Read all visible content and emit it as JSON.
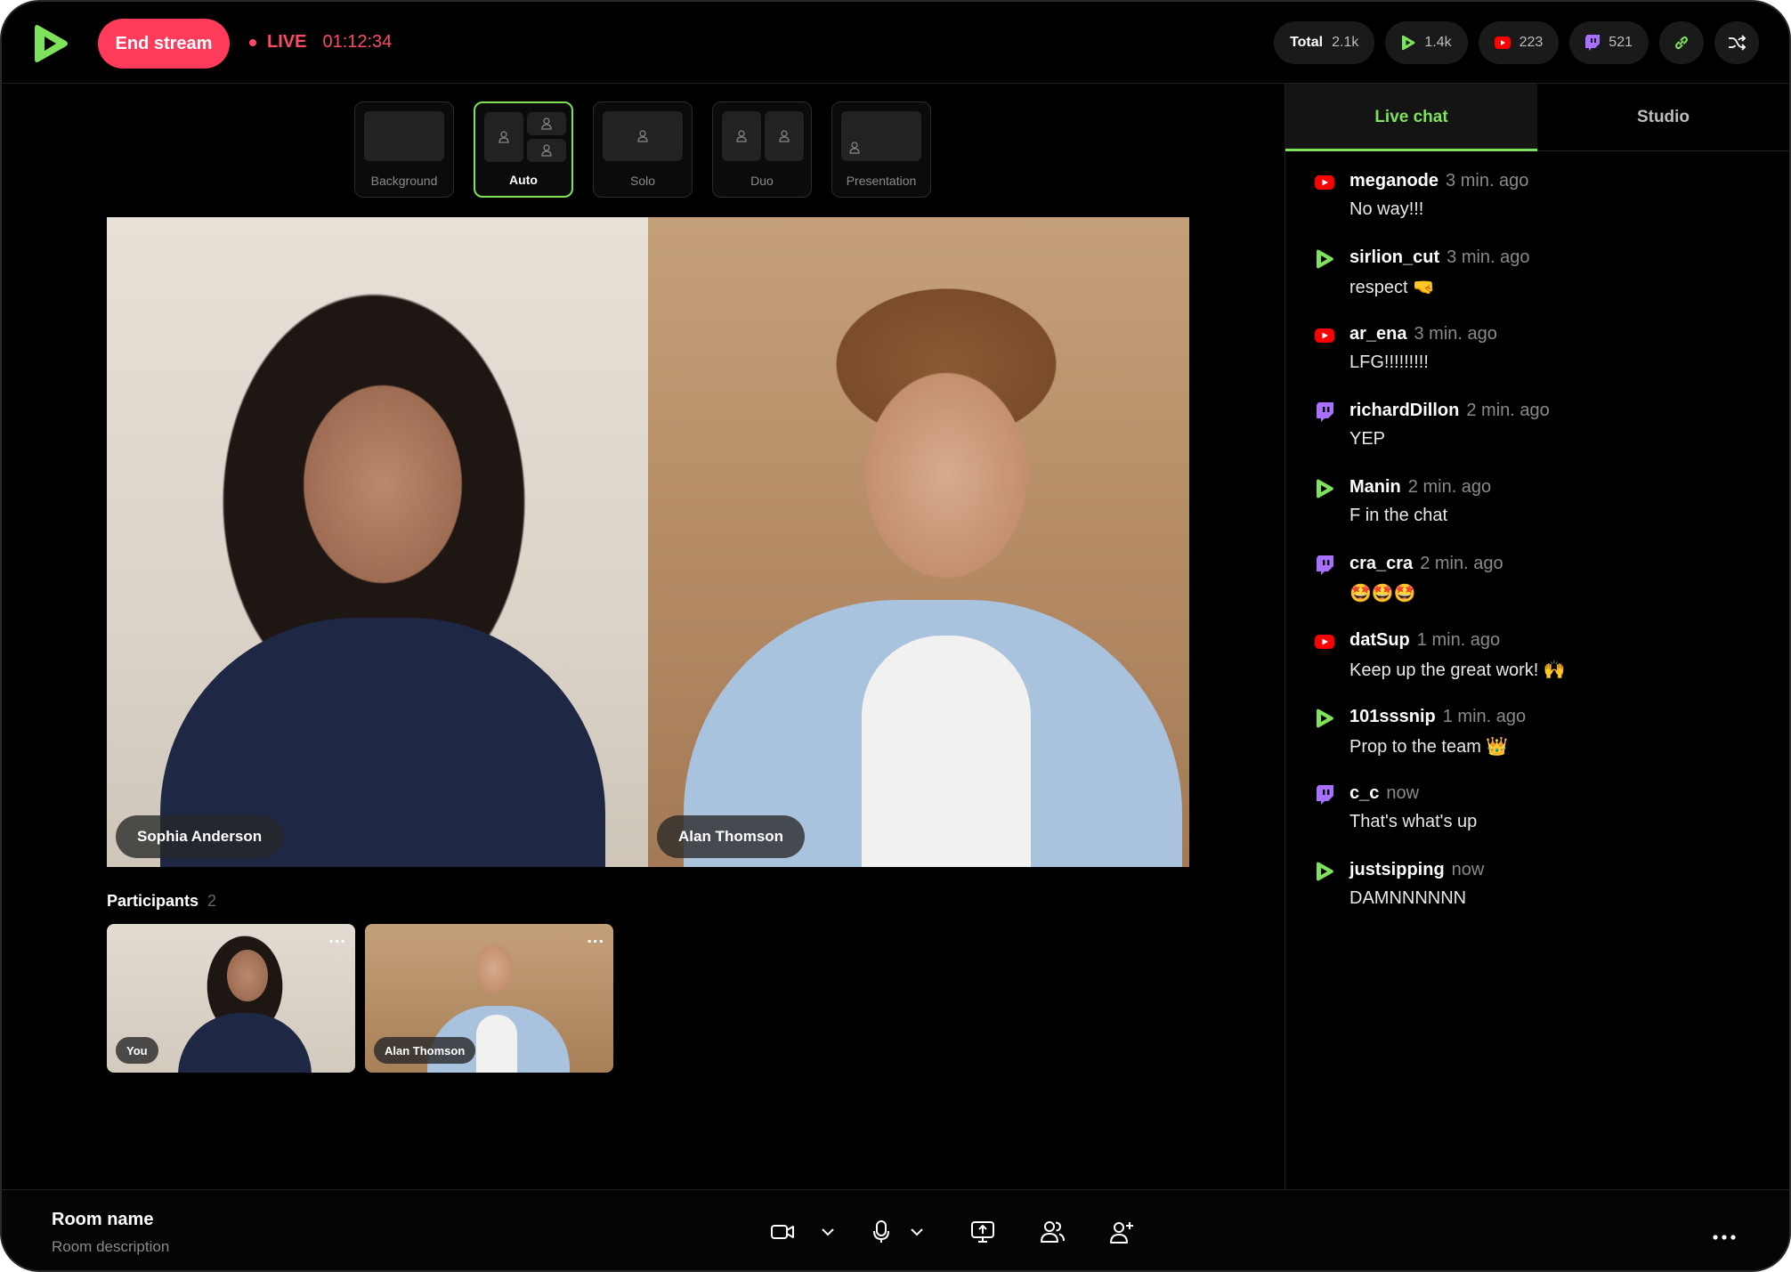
{
  "header": {
    "end_stream_label": "End stream",
    "live_label": "LIVE",
    "timer": "01:12:34",
    "stats": {
      "total_label": "Total",
      "total_value": "2.1k",
      "platform_a_value": "1.4k",
      "youtube_value": "223",
      "twitch_value": "521"
    }
  },
  "layouts": [
    {
      "label": "Background"
    },
    {
      "label": "Auto"
    },
    {
      "label": "Solo"
    },
    {
      "label": "Duo"
    },
    {
      "label": "Presentation"
    }
  ],
  "stage": {
    "speakers": [
      {
        "name": "Sophia Anderson"
      },
      {
        "name": "Alan Thomson"
      }
    ]
  },
  "participants": {
    "title": "Participants",
    "count": "2",
    "tiles": [
      {
        "name": "You",
        "menu": "..."
      },
      {
        "name": "Alan Thomson",
        "menu": "..."
      }
    ]
  },
  "chat": {
    "tabs": [
      {
        "label": "Live chat"
      },
      {
        "label": "Studio"
      }
    ],
    "messages": [
      {
        "platform": "youtube",
        "user": "meganode",
        "time": "3 min. ago",
        "text": "No way!!!"
      },
      {
        "platform": "green",
        "user": "sirlion_cut",
        "time": "3 min. ago",
        "text": "respect 🤜"
      },
      {
        "platform": "youtube",
        "user": "ar_ena",
        "time": "3 min. ago",
        "text": "LFG!!!!!!!!!"
      },
      {
        "platform": "twitch",
        "user": "richardDillon",
        "time": "2 min. ago",
        "text": "YEP"
      },
      {
        "platform": "green",
        "user": "Manin",
        "time": "2 min. ago",
        "text": "F in the chat"
      },
      {
        "platform": "twitch",
        "user": "cra_cra",
        "time": "2 min. ago",
        "text": "🤩🤩🤩"
      },
      {
        "platform": "youtube",
        "user": "datSup",
        "time": "1 min. ago",
        "text": "Keep up the great work! 🙌"
      },
      {
        "platform": "green",
        "user": "101sssnip",
        "time": "1 min. ago",
        "text": "Prop to the team 👑"
      },
      {
        "platform": "twitch",
        "user": "c_c",
        "time": "now",
        "text": "That's what's up"
      },
      {
        "platform": "green",
        "user": "justsipping",
        "time": "now",
        "text": "DAMNNNNNN"
      }
    ]
  },
  "footer": {
    "room_name": "Room name",
    "room_description": "Room description"
  },
  "colors": {
    "accent": "#7ee25a",
    "live": "#ff3b5c",
    "youtube": "#ff0000",
    "twitch": "#9146ff"
  },
  "icons": [
    "logo-play-icon",
    "link-icon",
    "shuffle-icon",
    "camera-icon",
    "microphone-icon",
    "screen-share-icon",
    "people-icon",
    "add-person-icon",
    "more-icon",
    "youtube-icon",
    "twitch-icon",
    "person-icon"
  ]
}
